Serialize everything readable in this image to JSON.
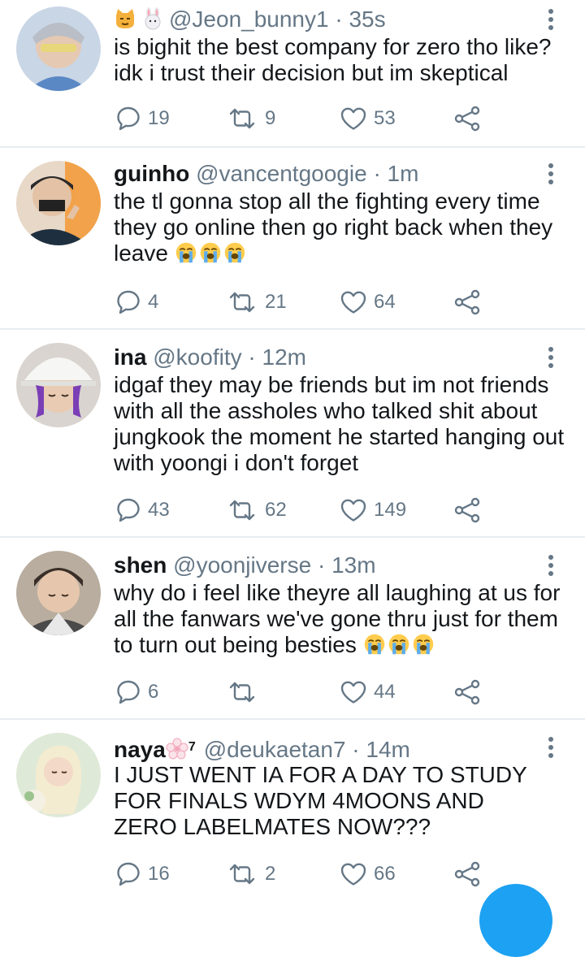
{
  "tweets": [
    {
      "name": "",
      "handle": "@Jeon_bunny1",
      "separator": "·",
      "time": "35s",
      "text": "is bighit the best company for zero tho like? idk i trust their decision but im skeptical",
      "replies": "19",
      "retweets": "9",
      "likes": "53"
    },
    {
      "name": "guinho",
      "handle": "@vancentgoogie",
      "separator": "·",
      "time": "1m",
      "text": "the tl gonna stop all the fighting every time they go online then go right back when they leave",
      "replies": "4",
      "retweets": "21",
      "likes": "64"
    },
    {
      "name": "ina",
      "handle": "@koofity",
      "separator": "·",
      "time": "12m",
      "text": "idgaf they may be friends but im not friends with all the assholes who talked shit about jungkook the moment he started hanging out with yoongi i don't forget",
      "replies": "43",
      "retweets": "62",
      "likes": "149"
    },
    {
      "name": "shen",
      "handle": "@yoonjiverse",
      "separator": "·",
      "time": "13m",
      "text": "why do i feel like theyre all laughing at us for all the fanwars we've gone thru just for them to turn out being besties",
      "replies": "6",
      "retweets": "",
      "likes": "44"
    },
    {
      "name": "naya",
      "name_sup": "7",
      "handle": "@deukaetan7",
      "separator": "·",
      "time": "14m",
      "text": "I JUST WENT IA FOR A DAY TO STUDY FOR FINALS WDYM 4MOONS AND ZERO LABELMATES NOW???",
      "replies": "16",
      "retweets": "2",
      "likes": "66"
    }
  ],
  "colors": {
    "text": "#14171a",
    "secondary": "#657786",
    "divider": "#e6ecf0",
    "accent": "#1da1f2"
  },
  "icons": [
    "reply-icon",
    "retweet-icon",
    "like-icon",
    "share-icon",
    "more-options-icon",
    "loudly-crying-emoji",
    "cat-emoji",
    "rabbit-emoji",
    "cherry-blossom-emoji"
  ]
}
